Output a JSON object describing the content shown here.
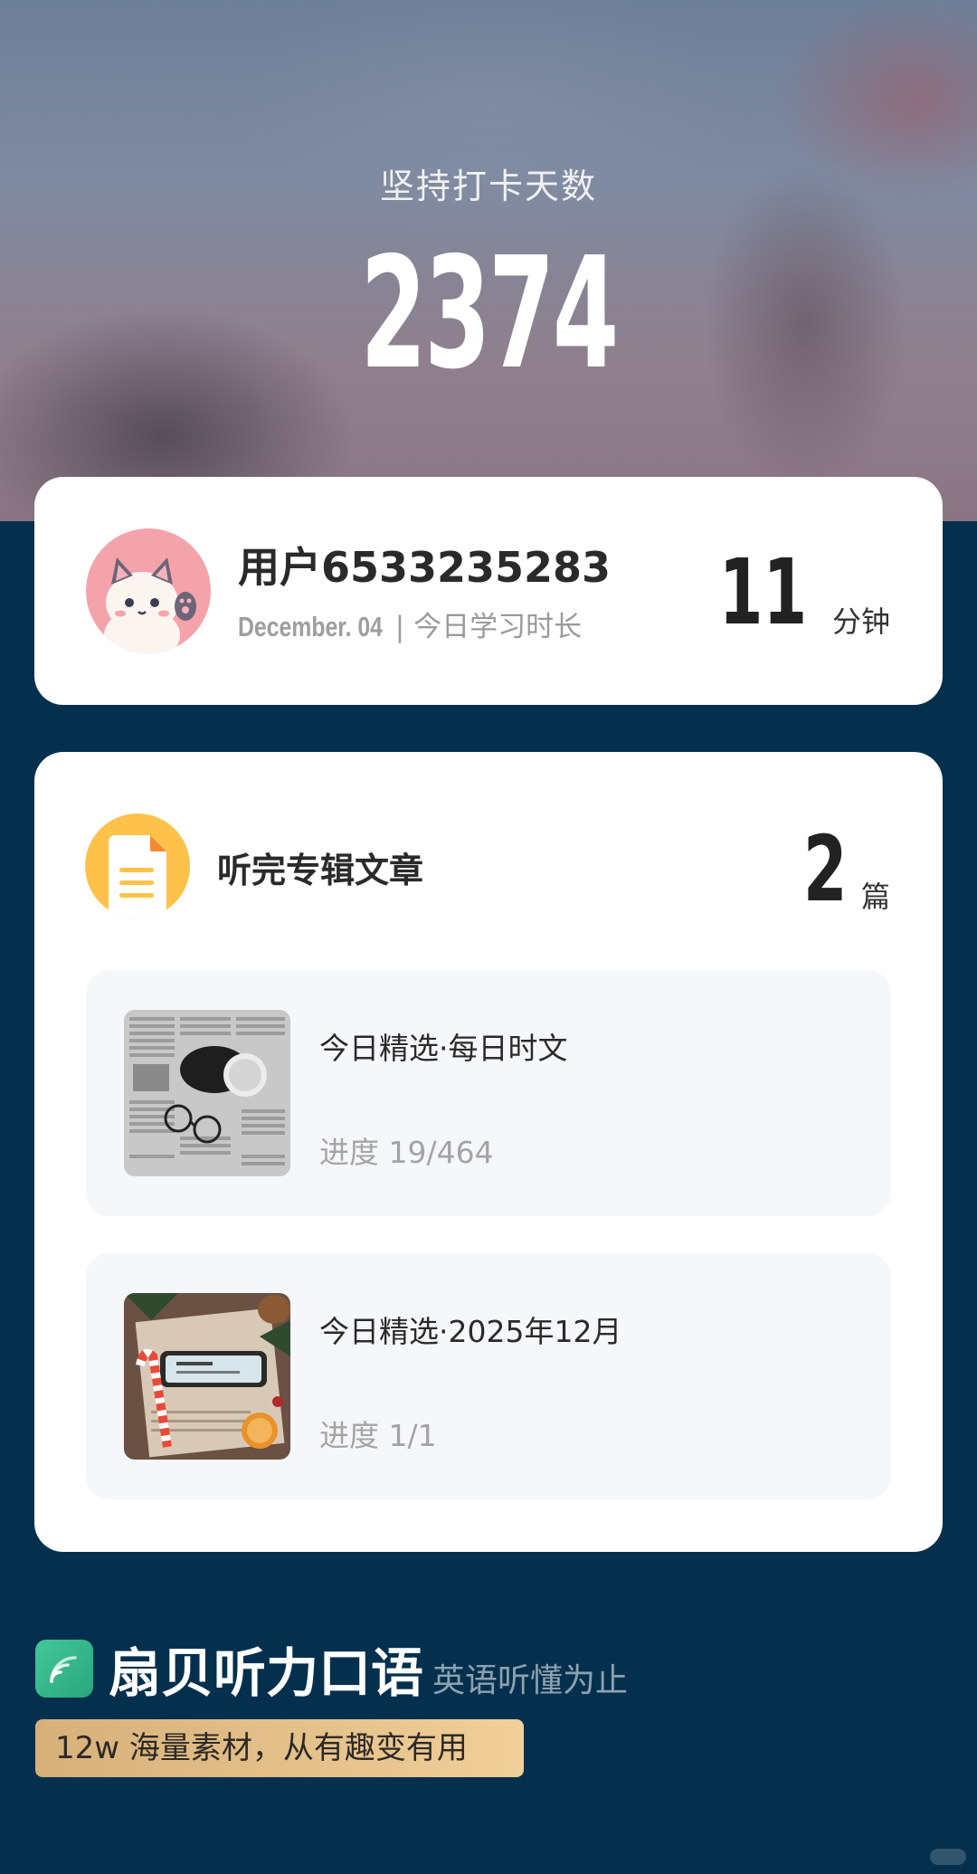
{
  "hero": {
    "title": "坚持打卡天数",
    "days": "2374"
  },
  "user_card": {
    "name": "用户6533235283",
    "date": "December. 04",
    "separator": " | ",
    "date_caption": "今日学习时长",
    "minutes": "11",
    "minutes_unit": "分钟"
  },
  "articles": {
    "title": "听完专辑文章",
    "count": "2",
    "count_unit": "篇",
    "items": [
      {
        "title": "今日精选·每日时文",
        "progress": "进度 19/464",
        "thumbnail": "newspaper-coffee-glasses"
      },
      {
        "title": "今日精选·2025年12月",
        "progress": "进度 1/1",
        "thumbnail": "december-phone-christmas"
      }
    ]
  },
  "brand": {
    "name": "扇贝听力口语",
    "slogan": "英语听懂为止",
    "tagline": "12w 海量素材，从有趣变有用",
    "icon": "sound-waves-icon"
  },
  "colors": {
    "background": "#04304e",
    "card": "#ffffff",
    "item_bg": "#f6f7fb",
    "doc_icon": "#fec24a",
    "brand_green": "#3dbb8f",
    "tag_gold": "#e6c48d"
  }
}
